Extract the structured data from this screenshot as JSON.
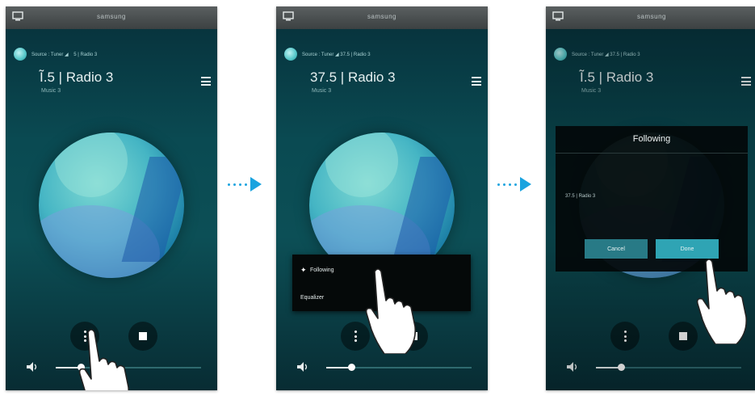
{
  "colors": {
    "accent": "#1aa3df",
    "button_ok": "#2fa4b4",
    "button_cancel": "#287a86"
  },
  "screens": [
    {
      "status_title": "samsung",
      "source": "Source : Tuner ◢     5 | Radio 3",
      "station": "Ĩ.5 | Radio 3",
      "station_sub": "Music 3",
      "volume_fraction": 0.17
    },
    {
      "status_title": "samsung",
      "source": "Source : Tuner ◢  37.5 | Radio 3",
      "station": "37.5 | Radio 3",
      "station_sub": "Music 3",
      "volume_fraction": 0.17,
      "popup": {
        "item1": "Following",
        "item2": "Equalizer"
      }
    },
    {
      "status_title": "samsung",
      "source": "Source : Tuner ◢  37.5 | Radio 3",
      "station": "Ĩ.5 | Radio 3",
      "station_sub": "Music 3",
      "volume_fraction": 0.17,
      "dialog": {
        "title": "Following",
        "body": "37.5 | Radio 3",
        "cancel": "Cancel",
        "ok": "Done"
      }
    }
  ],
  "icons": {
    "status": "screen-icon",
    "source": "source-icon",
    "menu": "menu-icon",
    "more": "more-options-icon",
    "stop": "stop-icon",
    "volume": "volume-icon",
    "arrow": "arrow-right-icon",
    "hand": "tap-hand-icon"
  }
}
